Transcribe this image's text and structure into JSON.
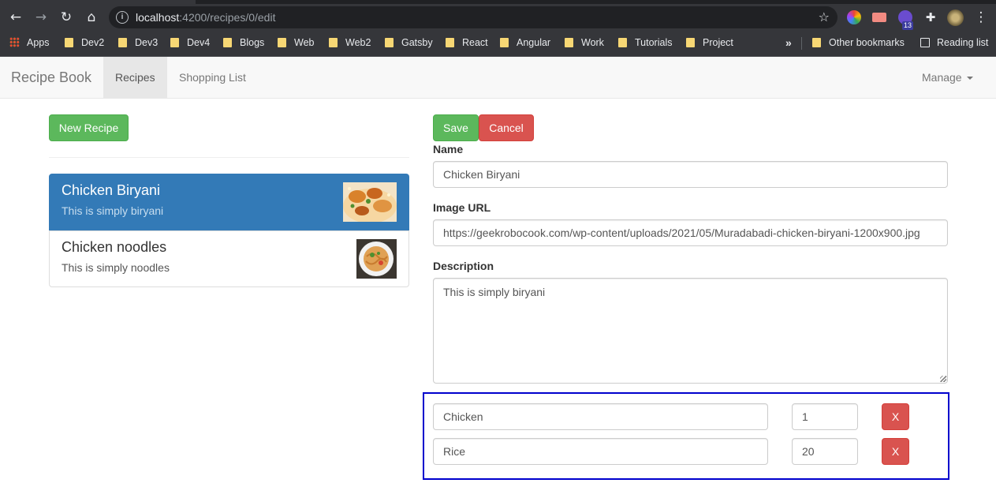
{
  "browser": {
    "url_host": "localhost",
    "url_path": ":4200/recipes/0/edit",
    "extension_badge": "13",
    "bookmarks": [
      "Apps",
      "Dev2",
      "Dev3",
      "Dev4",
      "Blogs",
      "Web",
      "Web2",
      "Gatsby",
      "React",
      "Angular",
      "Work",
      "Tutorials",
      "Project"
    ],
    "overflow_label": "»",
    "other_bookmarks": "Other bookmarks",
    "reading_list": "Reading list"
  },
  "navbar": {
    "brand": "Recipe Book",
    "links": [
      "Recipes",
      "Shopping List"
    ],
    "manage": "Manage"
  },
  "list": {
    "new_button": "New Recipe",
    "recipes": [
      {
        "name": "Chicken Biryani",
        "description": "This is simply biryani"
      },
      {
        "name": "Chicken noodles",
        "description": "This is simply noodles"
      }
    ]
  },
  "form": {
    "save_label": "Save",
    "cancel_label": "Cancel",
    "name_label": "Name",
    "name_value": "Chicken Biryani",
    "image_label": "Image URL",
    "image_value": "https://geekrobocook.com/wp-content/uploads/2021/05/Muradabadi-chicken-biryani-1200x900.jpg",
    "description_label": "Description",
    "description_value": "This is simply biryani",
    "ingredients": [
      {
        "name": "Chicken",
        "amount": "1",
        "delete_label": "X"
      },
      {
        "name": "Rice",
        "amount": "20",
        "delete_label": "X"
      }
    ]
  },
  "colors": {
    "primary": "#337ab7",
    "success": "#5cb85c",
    "danger": "#d9534f",
    "highlight_border": "#0000cd"
  }
}
